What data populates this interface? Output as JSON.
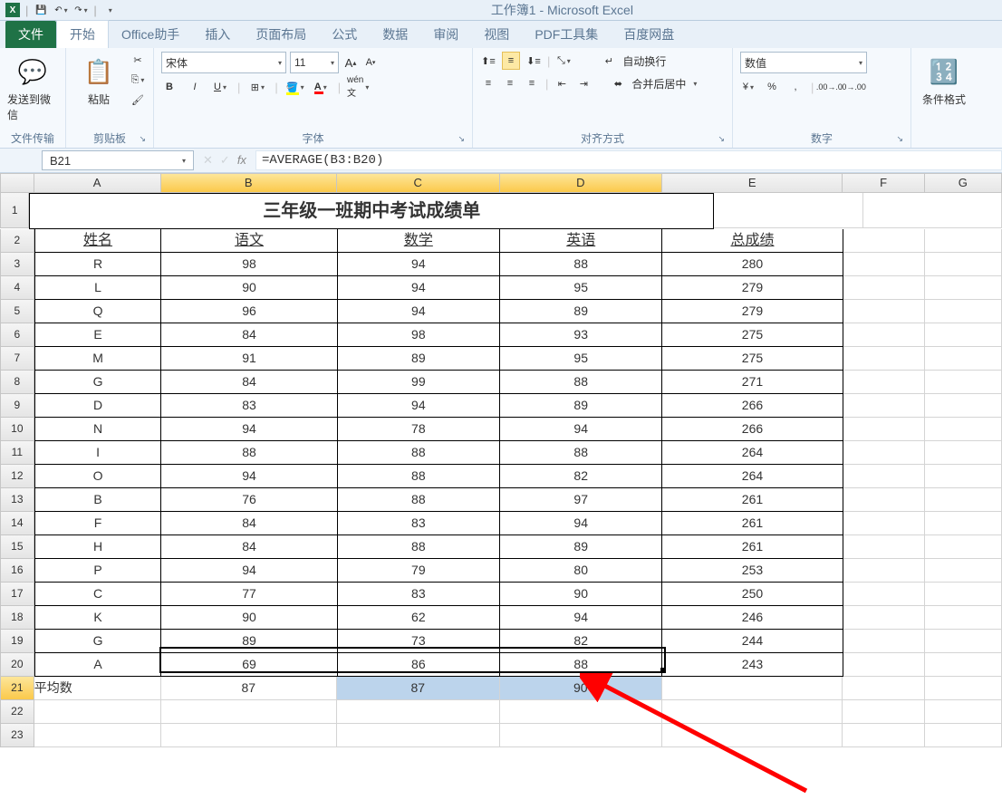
{
  "window_title": "工作簿1 - Microsoft Excel",
  "tabs": {
    "file": "文件",
    "list": [
      "开始",
      "Office助手",
      "插入",
      "页面布局",
      "公式",
      "数据",
      "审阅",
      "视图",
      "PDF工具集",
      "百度网盘"
    ],
    "active": 0
  },
  "ribbon": {
    "group_filesend": "文件传输",
    "btn_wechat": "发送到微信",
    "group_clipboard": "剪贴板",
    "btn_paste": "粘贴",
    "group_font": "字体",
    "font_name": "宋体",
    "font_size": "11",
    "group_align": "对齐方式",
    "wrap_text": "自动换行",
    "merge_center": "合并后居中",
    "group_number": "数字",
    "number_format": "数值",
    "group_styles": "条件格式"
  },
  "formula_bar": {
    "name_box": "B21",
    "formula": "=AVERAGE(B3:B20)"
  },
  "columns": [
    "A",
    "B",
    "C",
    "D",
    "E",
    "F",
    "G"
  ],
  "sheet": {
    "title": "三年级一班期中考试成绩单",
    "headers": [
      "姓名",
      "语文",
      "数学",
      "英语",
      "总成绩"
    ],
    "rows": [
      [
        "R",
        "98",
        "94",
        "88",
        "280"
      ],
      [
        "L",
        "90",
        "94",
        "95",
        "279"
      ],
      [
        "Q",
        "96",
        "94",
        "89",
        "279"
      ],
      [
        "E",
        "84",
        "98",
        "93",
        "275"
      ],
      [
        "M",
        "91",
        "89",
        "95",
        "275"
      ],
      [
        "G",
        "84",
        "99",
        "88",
        "271"
      ],
      [
        "D",
        "83",
        "94",
        "89",
        "266"
      ],
      [
        "N",
        "94",
        "78",
        "94",
        "266"
      ],
      [
        "I",
        "88",
        "88",
        "88",
        "264"
      ],
      [
        "O",
        "94",
        "88",
        "82",
        "264"
      ],
      [
        "B",
        "76",
        "88",
        "97",
        "261"
      ],
      [
        "F",
        "84",
        "83",
        "94",
        "261"
      ],
      [
        "H",
        "84",
        "88",
        "89",
        "261"
      ],
      [
        "P",
        "94",
        "79",
        "80",
        "253"
      ],
      [
        "C",
        "77",
        "83",
        "90",
        "250"
      ],
      [
        "K",
        "90",
        "62",
        "94",
        "246"
      ],
      [
        "G",
        "89",
        "73",
        "82",
        "244"
      ],
      [
        "A",
        "69",
        "86",
        "88",
        "243"
      ]
    ],
    "avg_label": "平均数",
    "avg_values": [
      "87",
      "87",
      "90"
    ]
  }
}
